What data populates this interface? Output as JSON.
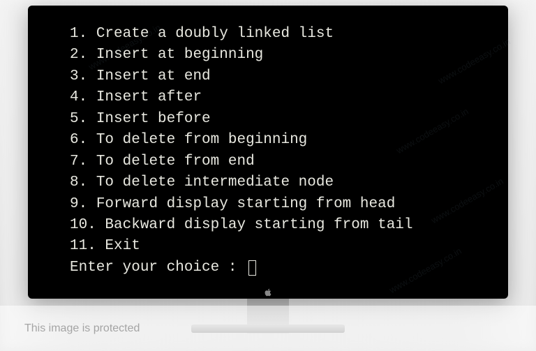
{
  "menu": {
    "items": [
      {
        "num": "1.",
        "label": "Create a doubly linked list"
      },
      {
        "num": "2.",
        "label": "Insert at beginning"
      },
      {
        "num": "3.",
        "label": "Insert at end"
      },
      {
        "num": "4.",
        "label": "Insert after"
      },
      {
        "num": "5.",
        "label": "Insert before"
      },
      {
        "num": "6.",
        "label": "To delete from beginning"
      },
      {
        "num": "7.",
        "label": "To delete from end"
      },
      {
        "num": "8.",
        "label": "To delete intermediate node"
      },
      {
        "num": "9.",
        "label": "Forward display starting from head"
      },
      {
        "num": "10.",
        "label": "Backward display starting from tail"
      },
      {
        "num": "11.",
        "label": "Exit"
      }
    ],
    "prompt": "Enter your choice : "
  },
  "watermark": "www.codeeasy.co.in",
  "banner": "This image is protected"
}
